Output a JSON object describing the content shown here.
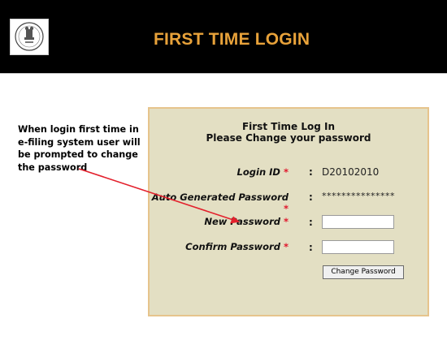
{
  "header": {
    "title": "FIRST TIME LOGIN"
  },
  "note": {
    "lines": [
      "When login first time in",
      "e-filing system user will",
      "be prompted to change",
      "the password"
    ]
  },
  "form": {
    "heading_line1": "First Time Log In",
    "heading_line2": "Please Change your password",
    "required_marker": "*",
    "separator": ":",
    "fields": [
      {
        "label": "Login ID",
        "value": "D20102010"
      },
      {
        "label": "Auto Generated Password",
        "value": "***************"
      },
      {
        "label": "New Password",
        "value": ""
      },
      {
        "label": "Confirm Password",
        "value": ""
      }
    ],
    "change_button_label": "Change Password"
  },
  "colors": {
    "header_bg": "#000000",
    "title": "#e8a23a",
    "panel_bg": "#e3dfc3",
    "panel_border": "#e6c48c",
    "required": "#e0162b",
    "arrow": "#e3202c"
  },
  "icons": {
    "logo": "court-emblem-logo"
  }
}
